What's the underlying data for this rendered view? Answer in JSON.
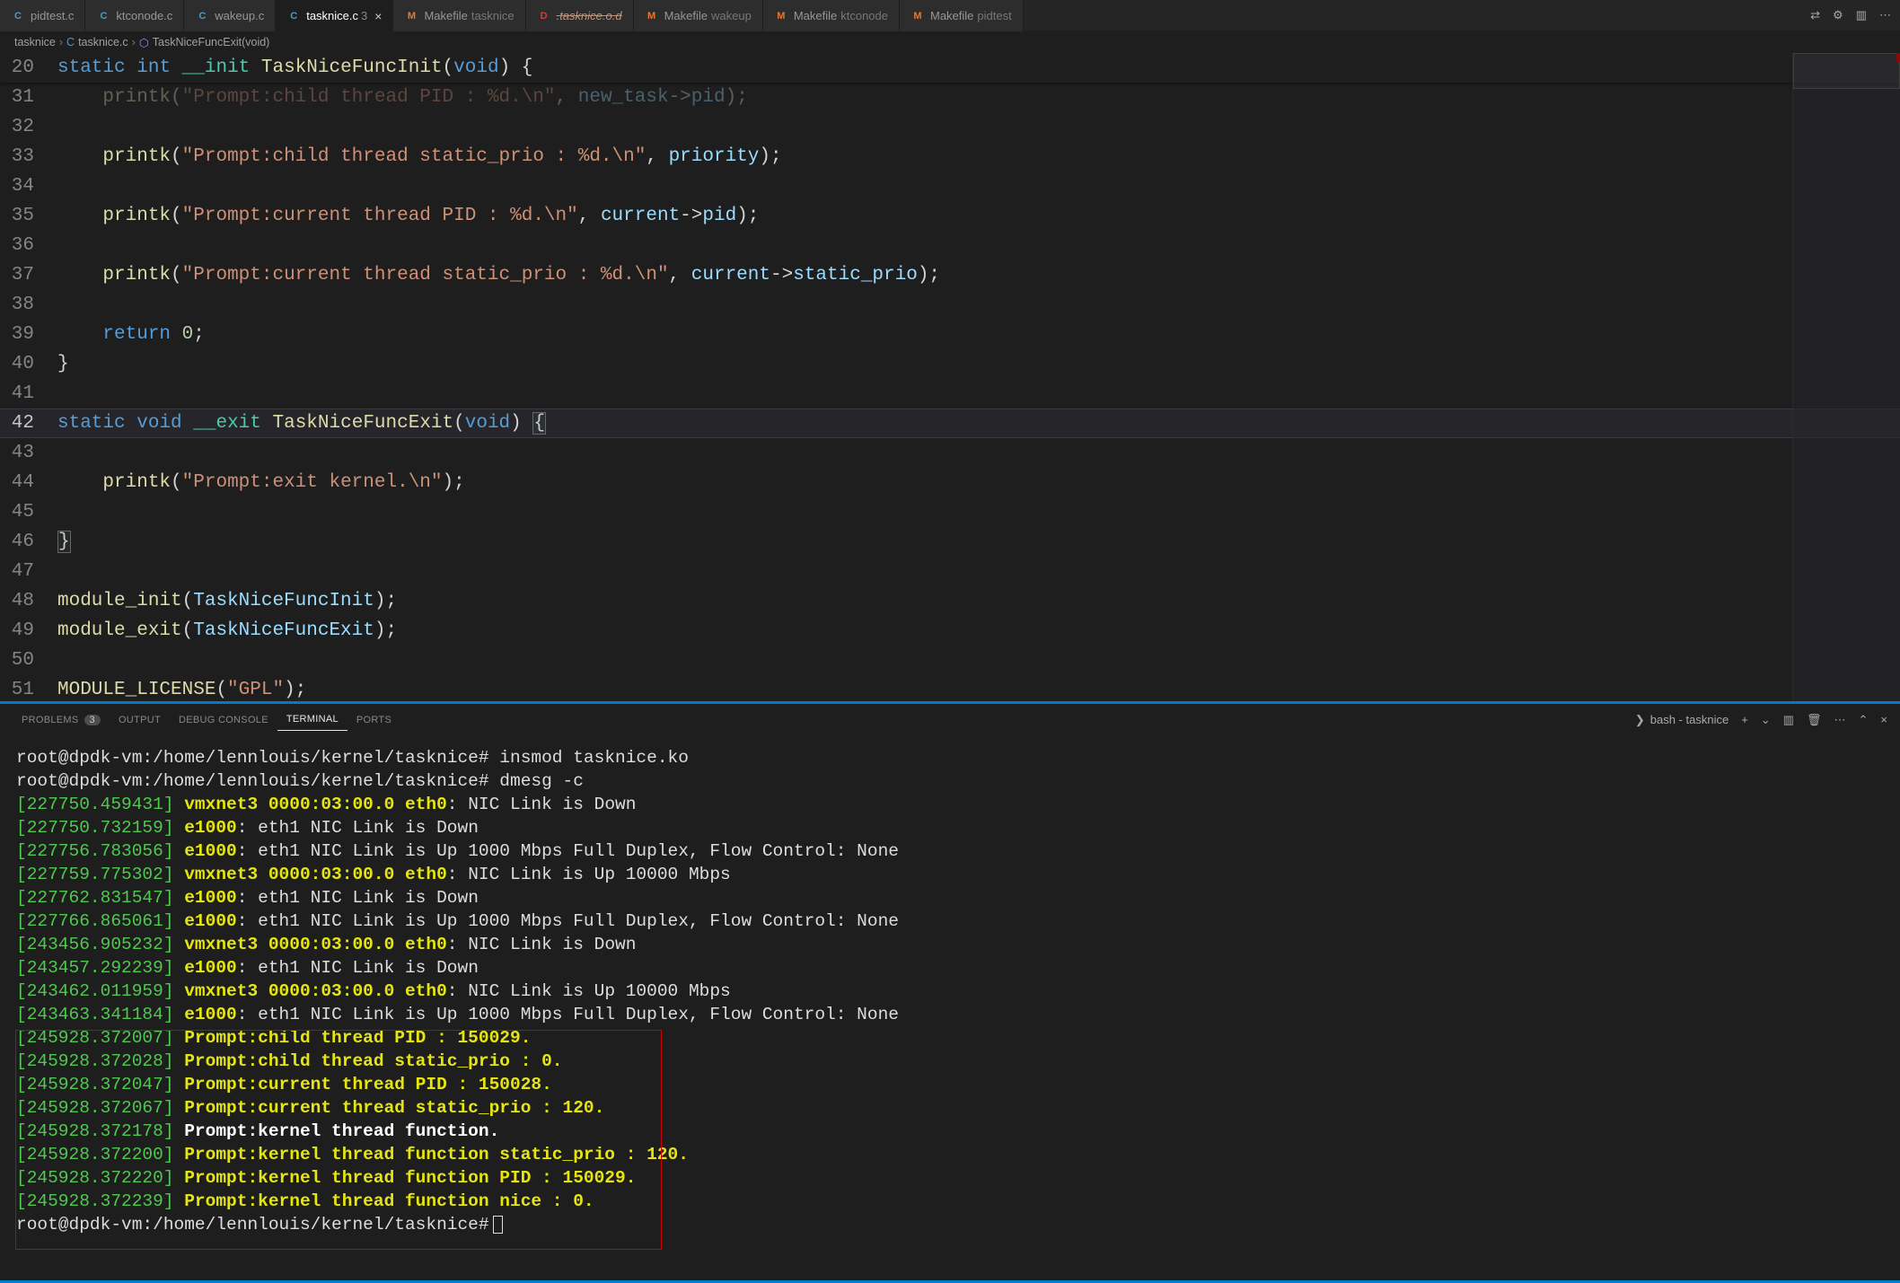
{
  "tabs": [
    {
      "icon": "C",
      "name": "pidtest.c",
      "cls": "icon-c"
    },
    {
      "icon": "C",
      "name": "ktconode.c",
      "cls": "icon-c"
    },
    {
      "icon": "C",
      "name": "wakeup.c",
      "cls": "icon-c"
    },
    {
      "icon": "C",
      "name": "tasknice.c",
      "cls": "icon-c",
      "active": true,
      "dirty": "3"
    },
    {
      "icon": "M",
      "name": "Makefile",
      "folder": "tasknice",
      "cls": "icon-m"
    },
    {
      "icon": "D",
      "name": ".tasknice.o.d",
      "cls": "icon-d",
      "strike": true
    },
    {
      "icon": "M",
      "name": "Makefile",
      "folder": "wakeup",
      "cls": "icon-m"
    },
    {
      "icon": "M",
      "name": "Makefile",
      "folder": "ktconode",
      "cls": "icon-m"
    },
    {
      "icon": "M",
      "name": "Makefile",
      "folder": "pidtest",
      "cls": "icon-m"
    }
  ],
  "breadcrumb": {
    "folder": "tasknice",
    "file": "tasknice.c",
    "symbol": "TaskNiceFuncExit(void)"
  },
  "code_lines": [
    {
      "n": 20,
      "sticky": true,
      "tokens": [
        [
          "kw",
          "static"
        ],
        [
          "plain",
          " "
        ],
        [
          "kw",
          "int"
        ],
        [
          "plain",
          " "
        ],
        [
          "type",
          "__init"
        ],
        [
          "plain",
          " "
        ],
        [
          "fn",
          "TaskNiceFuncInit"
        ],
        [
          "plain",
          "("
        ],
        [
          "kw",
          "void"
        ],
        [
          "plain",
          ") {"
        ]
      ]
    },
    {
      "n": 31,
      "tokens": [
        [
          "plain",
          "    "
        ],
        [
          "fn",
          "printk"
        ],
        [
          "plain",
          "("
        ],
        [
          "str",
          "\"Prompt:child thread PID : %d.\\n\""
        ],
        [
          "plain",
          ", "
        ],
        [
          "var",
          "new_task"
        ],
        [
          "plain",
          "->"
        ],
        [
          "var",
          "pid"
        ],
        [
          "plain",
          ");"
        ]
      ],
      "dim": true
    },
    {
      "n": 32,
      "tokens": []
    },
    {
      "n": 33,
      "tokens": [
        [
          "plain",
          "    "
        ],
        [
          "fn",
          "printk"
        ],
        [
          "plain",
          "("
        ],
        [
          "str",
          "\"Prompt:child thread static_prio : %d.\\n\""
        ],
        [
          "plain",
          ", "
        ],
        [
          "var",
          "priority"
        ],
        [
          "plain",
          ");"
        ]
      ]
    },
    {
      "n": 34,
      "tokens": []
    },
    {
      "n": 35,
      "tokens": [
        [
          "plain",
          "    "
        ],
        [
          "fn",
          "printk"
        ],
        [
          "plain",
          "("
        ],
        [
          "str",
          "\"Prompt:current thread PID : %d.\\n\""
        ],
        [
          "plain",
          ", "
        ],
        [
          "var",
          "current"
        ],
        [
          "plain",
          "->"
        ],
        [
          "var",
          "pid"
        ],
        [
          "plain",
          ");"
        ]
      ]
    },
    {
      "n": 36,
      "tokens": []
    },
    {
      "n": 37,
      "tokens": [
        [
          "plain",
          "    "
        ],
        [
          "fn",
          "printk"
        ],
        [
          "plain",
          "("
        ],
        [
          "str",
          "\"Prompt:current thread static_prio : %d.\\n\""
        ],
        [
          "plain",
          ", "
        ],
        [
          "var",
          "current"
        ],
        [
          "plain",
          "->"
        ],
        [
          "var",
          "static_prio"
        ],
        [
          "plain",
          ");"
        ]
      ]
    },
    {
      "n": 38,
      "tokens": []
    },
    {
      "n": 39,
      "tokens": [
        [
          "plain",
          "    "
        ],
        [
          "kw",
          "return"
        ],
        [
          "plain",
          " "
        ],
        [
          "num",
          "0"
        ],
        [
          "plain",
          ";"
        ]
      ]
    },
    {
      "n": 40,
      "tokens": [
        [
          "plain",
          "}"
        ]
      ]
    },
    {
      "n": 41,
      "tokens": []
    },
    {
      "n": 42,
      "current": true,
      "tokens": [
        [
          "kw",
          "static"
        ],
        [
          "plain",
          " "
        ],
        [
          "kw",
          "void"
        ],
        [
          "plain",
          " "
        ],
        [
          "type",
          "__exit"
        ],
        [
          "plain",
          " "
        ],
        [
          "fn",
          "TaskNiceFuncExit"
        ],
        [
          "plain",
          "("
        ],
        [
          "kw",
          "void"
        ],
        [
          "plain",
          ") "
        ],
        [
          "brace",
          "{"
        ]
      ]
    },
    {
      "n": 43,
      "tokens": []
    },
    {
      "n": 44,
      "tokens": [
        [
          "plain",
          "    "
        ],
        [
          "fn",
          "printk"
        ],
        [
          "plain",
          "("
        ],
        [
          "str",
          "\"Prompt:exit kernel.\\n\""
        ],
        [
          "plain",
          ");"
        ]
      ]
    },
    {
      "n": 45,
      "tokens": []
    },
    {
      "n": 46,
      "tokens": [
        [
          "brace",
          "}"
        ]
      ]
    },
    {
      "n": 47,
      "tokens": []
    },
    {
      "n": 48,
      "tokens": [
        [
          "fn",
          "module_init"
        ],
        [
          "plain",
          "("
        ],
        [
          "var",
          "TaskNiceFuncInit"
        ],
        [
          "plain",
          ");"
        ]
      ]
    },
    {
      "n": 49,
      "tokens": [
        [
          "fn",
          "module_exit"
        ],
        [
          "plain",
          "("
        ],
        [
          "var",
          "TaskNiceFuncExit"
        ],
        [
          "plain",
          ");"
        ]
      ]
    },
    {
      "n": 50,
      "tokens": []
    },
    {
      "n": 51,
      "tokens": [
        [
          "fn",
          "MODULE_LICENSE"
        ],
        [
          "plain",
          "("
        ],
        [
          "str",
          "\"GPL\""
        ],
        [
          "plain",
          ");"
        ]
      ]
    }
  ],
  "panel_tabs": [
    {
      "label": "PROBLEMS",
      "badge": "3"
    },
    {
      "label": "OUTPUT"
    },
    {
      "label": "DEBUG CONSOLE"
    },
    {
      "label": "TERMINAL",
      "active": true
    },
    {
      "label": "PORTS"
    }
  ],
  "terminal_label": "bash - tasknice",
  "terminal": [
    {
      "type": "cmd",
      "prompt": "root@dpdk-vm:/home/lennlouis/kernel/tasknice#",
      "text": " insmod tasknice.ko"
    },
    {
      "type": "cmd",
      "prompt": "root@dpdk-vm:/home/lennlouis/kernel/tasknice#",
      "text": " dmesg -c"
    },
    {
      "type": "dmesg",
      "ts": "[227750.459431]",
      "drv": "vmxnet3 0000:03:00.0 eth0",
      "msg": ": NIC Link is Down"
    },
    {
      "type": "dmesg",
      "ts": "[227750.732159]",
      "drv": "e1000",
      "msg": ": eth1 NIC Link is Down"
    },
    {
      "type": "dmesg",
      "ts": "[227756.783056]",
      "drv": "e1000",
      "msg": ": eth1 NIC Link is Up 1000 Mbps Full Duplex, Flow Control: None"
    },
    {
      "type": "dmesg",
      "ts": "[227759.775302]",
      "drv": "vmxnet3 0000:03:00.0 eth0",
      "msg": ": NIC Link is Up 10000 Mbps"
    },
    {
      "type": "dmesg",
      "ts": "[227762.831547]",
      "drv": "e1000",
      "msg": ": eth1 NIC Link is Down"
    },
    {
      "type": "dmesg",
      "ts": "[227766.865061]",
      "drv": "e1000",
      "msg": ": eth1 NIC Link is Up 1000 Mbps Full Duplex, Flow Control: None"
    },
    {
      "type": "dmesg",
      "ts": "[243456.905232]",
      "drv": "vmxnet3 0000:03:00.0 eth0",
      "msg": ": NIC Link is Down"
    },
    {
      "type": "dmesg",
      "ts": "[243457.292239]",
      "drv": "e1000",
      "msg": ": eth1 NIC Link is Down"
    },
    {
      "type": "dmesg",
      "ts": "[243462.011959]",
      "drv": "vmxnet3 0000:03:00.0 eth0",
      "msg": ": NIC Link is Up 10000 Mbps"
    },
    {
      "type": "dmesg",
      "ts": "[243463.341184]",
      "drv": "e1000",
      "msg": ": eth1 NIC Link is Up 1000 Mbps Full Duplex, Flow Control: None"
    },
    {
      "type": "prompt",
      "ts": "[245928.372007]",
      "msg": "Prompt:child thread PID : 150029."
    },
    {
      "type": "prompt",
      "ts": "[245928.372028]",
      "msg": "Prompt:child thread static_prio : 0."
    },
    {
      "type": "prompt",
      "ts": "[245928.372047]",
      "msg": "Prompt:current thread PID : 150028."
    },
    {
      "type": "prompt",
      "ts": "[245928.372067]",
      "msg": "Prompt:current thread static_prio : 120."
    },
    {
      "type": "promptw",
      "ts": "[245928.372178]",
      "msg": "Prompt:kernel thread function."
    },
    {
      "type": "prompt",
      "ts": "[245928.372200]",
      "msg": "Prompt:kernel thread function static_prio : 120."
    },
    {
      "type": "prompt",
      "ts": "[245928.372220]",
      "msg": "Prompt:kernel thread function PID : 150029."
    },
    {
      "type": "prompt",
      "ts": "[245928.372239]",
      "msg": "Prompt:kernel thread function nice : 0."
    },
    {
      "type": "cmd",
      "prompt": "root@dpdk-vm:/home/lennlouis/kernel/tasknice#",
      "text": "",
      "cursor": true
    }
  ]
}
